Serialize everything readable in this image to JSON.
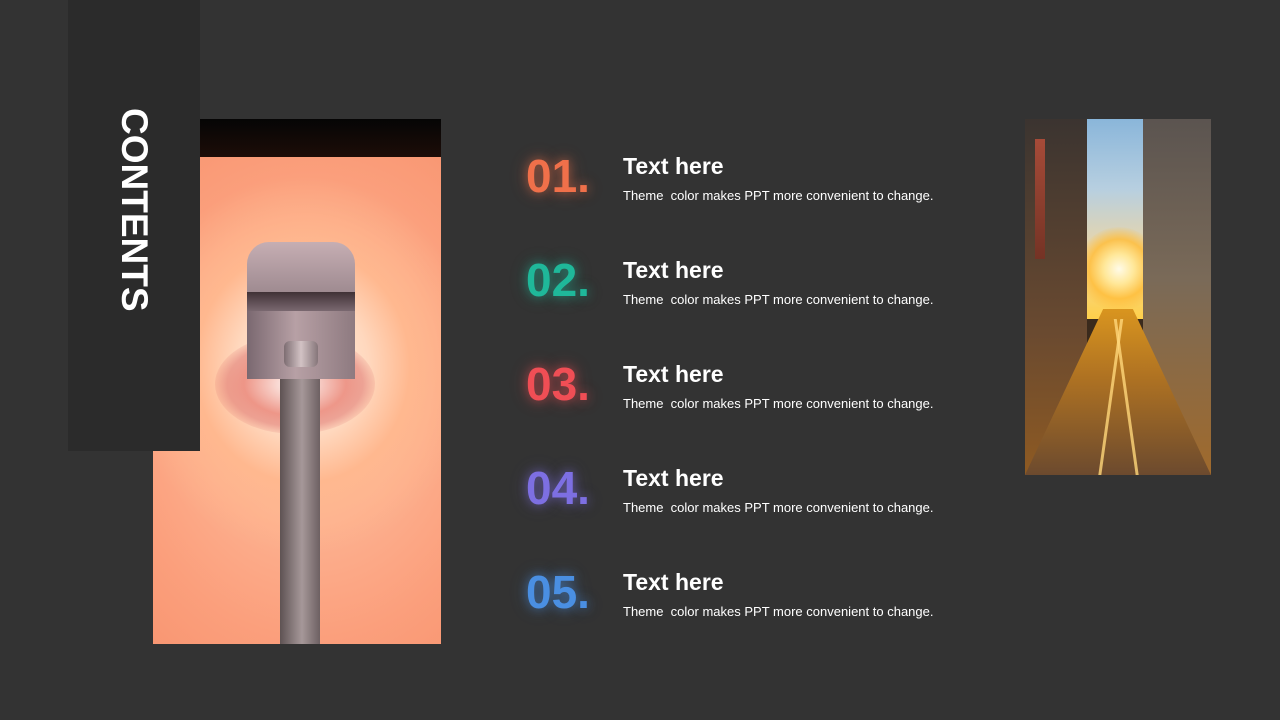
{
  "slide": {
    "heading": "CONTENTS",
    "items": [
      {
        "number": "01.",
        "title": "Text here",
        "desc": "Theme  color makes PPT more convenient to change.",
        "color": "#F0704A"
      },
      {
        "number": "02.",
        "title": "Text here",
        "desc": "Theme  color makes PPT more convenient to change.",
        "color": "#1FB89A"
      },
      {
        "number": "03.",
        "title": "Text here",
        "desc": "Theme  color makes PPT more convenient to change.",
        "color": "#F04E55"
      },
      {
        "number": "04.",
        "title": "Text here",
        "desc": "Theme  color makes PPT more convenient to change.",
        "color": "#7D6FE2"
      },
      {
        "number": "05.",
        "title": "Text here",
        "desc": "Theme  color makes PPT more convenient to change.",
        "color": "#4A8FE2"
      }
    ]
  },
  "images": {
    "left": "street-lamp-photo",
    "right": "sunset-street-photo"
  },
  "colors": {
    "background": "#333333",
    "contents_block": "#2B2B2B",
    "text": "#FFFFFF"
  }
}
